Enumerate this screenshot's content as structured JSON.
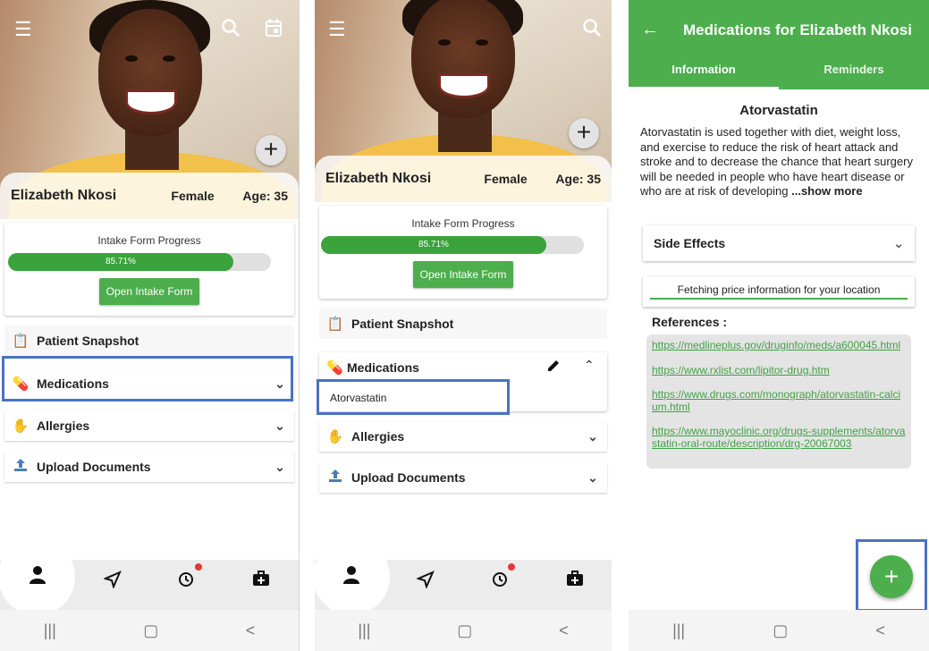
{
  "patient": {
    "name": "Elizabeth Nkosi",
    "gender": "Female",
    "age": "Age: 35"
  },
  "intake": {
    "title": "Intake Form Progress",
    "progress_text": "85.71%",
    "progress": 0.8571,
    "button_label": "Open Intake Form"
  },
  "sections": {
    "snapshot": "Patient Snapshot",
    "medications": "Medications",
    "allergies": "Allergies",
    "upload": "Upload Documents"
  },
  "medications_list": [
    "Atorvastatin"
  ],
  "nav": {
    "icons": [
      "person-icon",
      "send-icon",
      "history-icon",
      "medical-kit-icon"
    ]
  },
  "system_nav": {
    "recent": "|||",
    "home": "▢",
    "back": "<"
  },
  "detail": {
    "header_title": "Medications for Elizabeth Nkosi",
    "tabs": [
      "Information",
      "Reminders"
    ],
    "drug_name": "Atorvastatin",
    "description": "Atorvastatin is used together with diet, weight loss, and exercise to reduce the risk of heart attack and stroke and to decrease the chance that heart surgery will be needed in people who have heart disease or who are at risk of developing",
    "show_more": "...show more",
    "side_effects_label": "Side Effects",
    "fetching_text": "Fetching price information for your location",
    "references_title": "References :",
    "references": [
      "https://medlineplus.gov/druginfo/meds/a600045.html",
      "https://www.rxlist.com/lipitor-drug.htm",
      "https://www.drugs.com/monograph/atorvastatin-calcium.html",
      "https://www.mayoclinic.org/drugs-supplements/atorvastatin-oral-route/description/drg-20067003"
    ],
    "fab_label": "+"
  },
  "colors": {
    "brand_green": "#4cae4c",
    "highlight_blue": "#4a72c4",
    "alert_red": "#e53935"
  }
}
